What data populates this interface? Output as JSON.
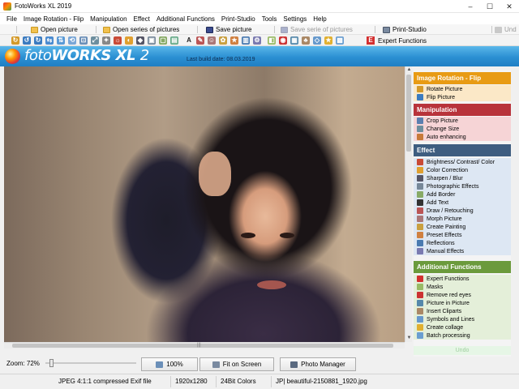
{
  "window": {
    "title": "FotoWorks XL 2019",
    "min": "–",
    "max": "☐",
    "close": "✕"
  },
  "menu": [
    "File",
    "Image Rotation - Flip",
    "Manipulation",
    "Effect",
    "Additional Functions",
    "Print-Studio",
    "Tools",
    "Settings",
    "Help"
  ],
  "toolbar": {
    "open_picture": "Open picture",
    "open_series": "Open series of pictures",
    "save_picture": "Save picture",
    "save_series": "Save serie of pictures",
    "print_studio": "Print-Studio",
    "undo": "Und",
    "expert_functions": "Expert Functions"
  },
  "banner": {
    "brand_a": "foto",
    "brand_b": "WORKS",
    "brand_c": " XL ",
    "brand_d": "2",
    "build": "Last build date: 08.03.2019"
  },
  "panel": {
    "rotation": {
      "title": "Image Rotation - Flip",
      "color": "#e89b14",
      "items": [
        "Rotate Picture",
        "Flip Picture"
      ]
    },
    "manipulation": {
      "title": "Manipulation",
      "color": "#b8333b",
      "items": [
        "Crop Picture",
        "Change Size",
        "Auto enhancing"
      ]
    },
    "effect": {
      "title": "Effect",
      "color": "#3e5d80",
      "items": [
        "Brightness/ Contrast/ Color",
        "Color Correction",
        "Sharpen / Blur",
        "Photographic Effects",
        "Add Border",
        "Add Text",
        "Draw / Retouching",
        "Morph Picture",
        "Create Painting",
        "Preset Effects",
        "Reflections",
        "Manual Effects"
      ]
    },
    "additional": {
      "title": "Additional Functions",
      "color": "#6b9a3c",
      "items": [
        "Expert Functions",
        "Masks",
        "Remove red eyes",
        "Picture in Picture",
        "Insert Cliparts",
        "Symbols and Lines",
        "Create collage",
        "Batch processing"
      ]
    },
    "undo": "Undo"
  },
  "bottom": {
    "zoom_label": "Zoom: 72%",
    "zoom_value": 0.05,
    "btn_100": "100%",
    "btn_fit": "Fit on Screen",
    "btn_manager": "Photo Manager"
  },
  "status": {
    "format": "JPEG 4:1:1 compressed Exif file",
    "dimensions": "1920x1280",
    "colors": "24Bit Colors",
    "filename": "JP| beautiful-2150881_1920.jpg"
  }
}
